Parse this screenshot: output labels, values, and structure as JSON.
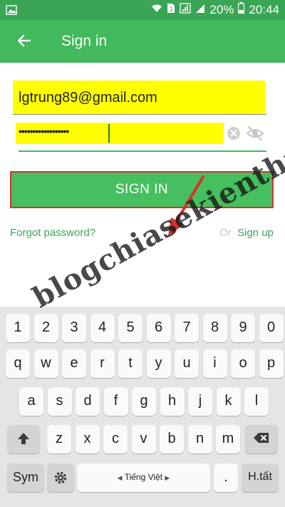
{
  "status_bar": {
    "battery": "20%",
    "time": "20:44"
  },
  "app_bar": {
    "title": "Sign in"
  },
  "form": {
    "email_value": "lgtrung89@gmail.com",
    "password_masked": "••••••••••••••••••",
    "sign_in_label": "SIGN IN",
    "forgot_label": "Forgot password?",
    "or_label": "Or",
    "signup_label": "Sign up"
  },
  "watermark": "blogchiasekienthuc.com",
  "keyboard": {
    "numbers": [
      "1",
      "2",
      "3",
      "4",
      "5",
      "6",
      "7",
      "8",
      "9",
      "0"
    ],
    "row1": [
      "q",
      "w",
      "e",
      "r",
      "t",
      "y",
      "u",
      "i",
      "o",
      "p"
    ],
    "row2": [
      "a",
      "s",
      "d",
      "f",
      "g",
      "h",
      "j",
      "k",
      "l"
    ],
    "row3": [
      "z",
      "x",
      "c",
      "v",
      "b",
      "n",
      "m"
    ],
    "sym_label": "Sym",
    "space_label": "Tiếng Việt",
    "period_label": ".",
    "done_label": "H.tất"
  },
  "colors": {
    "status_bar": "#3aa655",
    "app_bar": "#41b95c",
    "sign_in_button": "#46bf5e",
    "highlight": "#ffff00",
    "annotation_red": "#d93030"
  }
}
